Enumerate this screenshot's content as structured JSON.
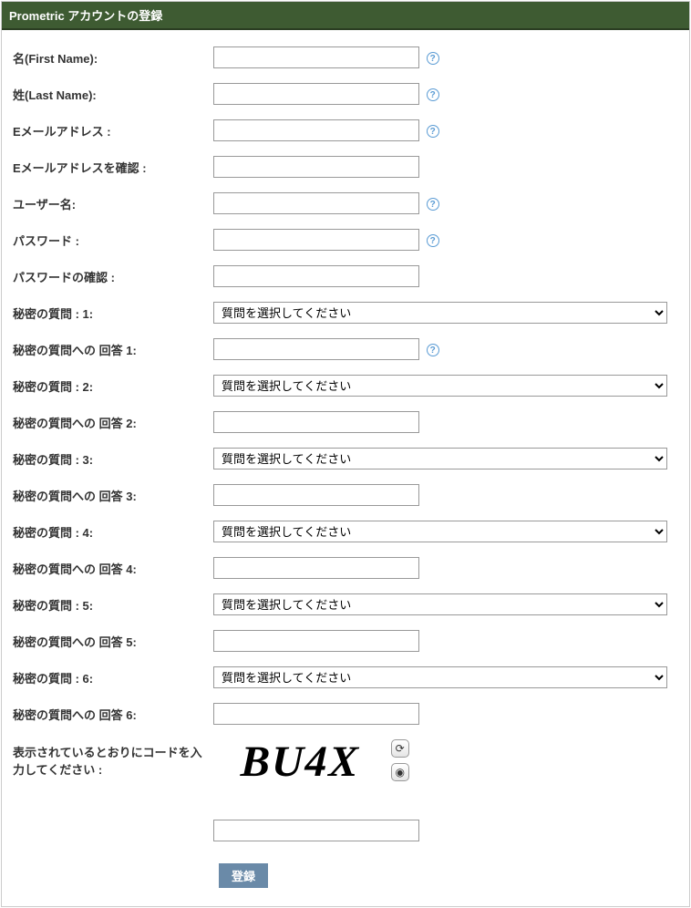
{
  "header": {
    "title": "Prometric アカウントの登録"
  },
  "labels": {
    "first_name": "名(First Name):",
    "last_name": "姓(Last Name):",
    "email": "Eメールアドレス :",
    "email_confirm": "Eメールアドレスを確認 :",
    "username": "ユーザー名:",
    "password": "パスワード :",
    "password_confirm": "パスワードの確認 :",
    "secret_q1": "秘密の質問 : 1:",
    "secret_a1": "秘密の質問への 回答 1:",
    "secret_q2": "秘密の質問 : 2:",
    "secret_a2": "秘密の質問への 回答 2:",
    "secret_q3": "秘密の質問 : 3:",
    "secret_a3": "秘密の質問への 回答 3:",
    "secret_q4": "秘密の質問 : 4:",
    "secret_a4": "秘密の質問への 回答 4:",
    "secret_q5": "秘密の質問 : 5:",
    "secret_a5": "秘密の質問への 回答 5:",
    "secret_q6": "秘密の質問 : 6:",
    "secret_a6": "秘密の質問への 回答 6:",
    "captcha_label": "表示されているとおりにコードを入力してください :"
  },
  "select_placeholder": "質問を選択してください",
  "values": {
    "first_name": "",
    "last_name": "",
    "email": "",
    "email_confirm": "",
    "username": "",
    "password": "",
    "password_confirm": "",
    "secret_a1": "",
    "secret_a2": "",
    "secret_a3": "",
    "secret_a4": "",
    "secret_a5": "",
    "secret_a6": "",
    "captcha_input": ""
  },
  "captcha_text": "BU4X",
  "submit_label": "登録",
  "help_icon_char": "?",
  "refresh_icon_char": "⟳",
  "audio_icon_char": "◉",
  "colors": {
    "header_bg": "#3e5b32",
    "submit_bg": "#6a8aa8"
  }
}
